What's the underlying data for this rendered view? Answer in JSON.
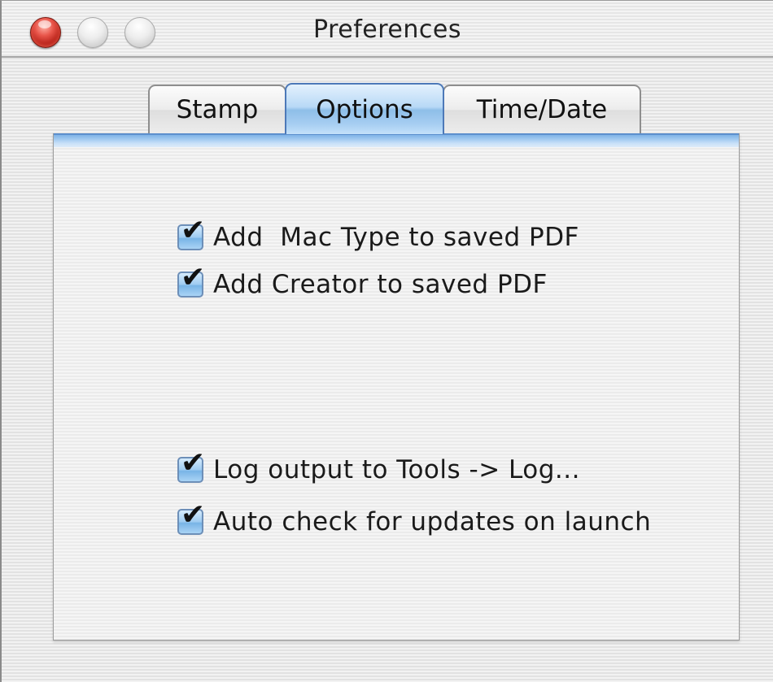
{
  "window": {
    "title": "Preferences"
  },
  "tabs": [
    {
      "label": "Stamp",
      "selected": false
    },
    {
      "label": "Options",
      "selected": true
    },
    {
      "label": "Time/Date",
      "selected": false
    }
  ],
  "options": [
    {
      "label": "Add  Mac Type to saved PDF",
      "checked": true
    },
    {
      "label": "Add Creator to saved PDF",
      "checked": true
    },
    {
      "label": "Log output to Tools -> Log...",
      "checked": true
    },
    {
      "label": "Auto check for updates on launch",
      "checked": true
    }
  ],
  "check_glyph": "✔",
  "colors": {
    "selected_tab": "#a7cef2",
    "close_button": "#e8554a"
  }
}
